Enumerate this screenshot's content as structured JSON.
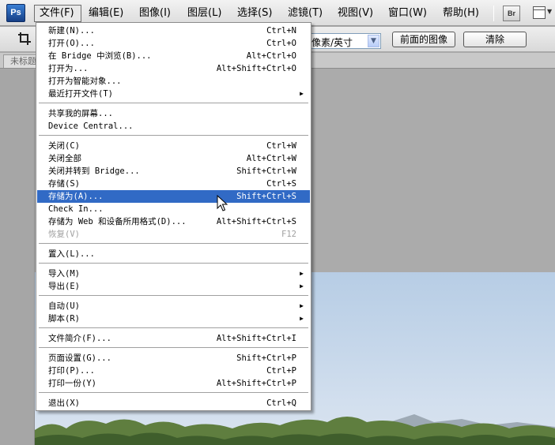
{
  "app": {
    "logo": "Ps"
  },
  "menubar": {
    "items": [
      {
        "label": "文件(F)",
        "active": true
      },
      {
        "label": "编辑(E)"
      },
      {
        "label": "图像(I)"
      },
      {
        "label": "图层(L)"
      },
      {
        "label": "选择(S)"
      },
      {
        "label": "滤镜(T)"
      },
      {
        "label": "视图(V)"
      },
      {
        "label": "窗口(W)"
      },
      {
        "label": "帮助(H)"
      }
    ],
    "bridge_button": "Br"
  },
  "options_bar": {
    "resolution_unit": "像素/英寸",
    "front_image_button": "前面的图像",
    "clear_button": "清除"
  },
  "document_tab": {
    "title": "未标题"
  },
  "file_menu": {
    "groups": [
      [
        {
          "label": "新建(N)...",
          "shortcut": "Ctrl+N"
        },
        {
          "label": "打开(O)...",
          "shortcut": "Ctrl+O"
        },
        {
          "label": "在 Bridge 中浏览(B)...",
          "shortcut": "Alt+Ctrl+O"
        },
        {
          "label": "打开为...",
          "shortcut": "Alt+Shift+Ctrl+O"
        },
        {
          "label": "打开为智能对象...",
          "shortcut": ""
        },
        {
          "label": "最近打开文件(T)",
          "shortcut": "",
          "submenu": true
        }
      ],
      [
        {
          "label": "共享我的屏幕...",
          "shortcut": ""
        },
        {
          "label": "Device Central...",
          "shortcut": ""
        }
      ],
      [
        {
          "label": "关闭(C)",
          "shortcut": "Ctrl+W"
        },
        {
          "label": "关闭全部",
          "shortcut": "Alt+Ctrl+W"
        },
        {
          "label": "关闭并转到 Bridge...",
          "shortcut": "Shift+Ctrl+W"
        },
        {
          "label": "存储(S)",
          "shortcut": "Ctrl+S"
        },
        {
          "label": "存储为(A)...",
          "shortcut": "Shift+Ctrl+S",
          "highlighted": true
        },
        {
          "label": "Check In...",
          "shortcut": ""
        },
        {
          "label": "存储为 Web 和设备所用格式(D)...",
          "shortcut": "Alt+Shift+Ctrl+S"
        },
        {
          "label": "恢复(V)",
          "shortcut": "F12",
          "disabled": true
        }
      ],
      [
        {
          "label": "置入(L)...",
          "shortcut": ""
        }
      ],
      [
        {
          "label": "导入(M)",
          "shortcut": "",
          "submenu": true
        },
        {
          "label": "导出(E)",
          "shortcut": "",
          "submenu": true
        }
      ],
      [
        {
          "label": "自动(U)",
          "shortcut": "",
          "submenu": true
        },
        {
          "label": "脚本(R)",
          "shortcut": "",
          "submenu": true
        }
      ],
      [
        {
          "label": "文件简介(F)...",
          "shortcut": "Alt+Shift+Ctrl+I"
        }
      ],
      [
        {
          "label": "页面设置(G)...",
          "shortcut": "Shift+Ctrl+P"
        },
        {
          "label": "打印(P)...",
          "shortcut": "Ctrl+P"
        },
        {
          "label": "打印一份(Y)",
          "shortcut": "Alt+Shift+Ctrl+P"
        }
      ],
      [
        {
          "label": "退出(X)",
          "shortcut": "Ctrl+Q"
        }
      ]
    ]
  },
  "colors": {
    "highlight": "#316ac5",
    "disabled_text": "#a0a0a0"
  },
  "icons": {
    "submenu": "triangle-right",
    "combo_arrow": "chevron-down",
    "crop_tool": "crop"
  }
}
